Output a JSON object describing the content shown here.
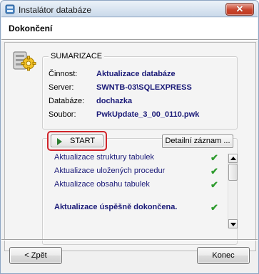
{
  "window": {
    "title": "Instalátor databáze"
  },
  "header": {
    "title": "Dokončení"
  },
  "summary": {
    "group_title": "SUMARIZACE",
    "rows": [
      {
        "label": "Činnost:",
        "value": "Aktualizace databáze"
      },
      {
        "label": "Server:",
        "value": "SWNTB-03\\SQLEXPRESS"
      },
      {
        "label": "Databáze:",
        "value": "dochazka"
      },
      {
        "label": "Soubor:",
        "value": "PwkUpdate_3_00_0110.pwk"
      }
    ]
  },
  "actions": {
    "start_label": "START",
    "detail_label": "Detailní záznam ..."
  },
  "log": {
    "items": [
      {
        "text": "Aktualizace struktury tabulek",
        "status": "done",
        "bold": false
      },
      {
        "text": "Aktualizace uložených procedur",
        "status": "done",
        "bold": false
      },
      {
        "text": "Aktualizace obsahu tabulek",
        "status": "done",
        "bold": false
      },
      {
        "text": "Aktualizace úspěšně dokončena.",
        "status": "done",
        "bold": true
      }
    ],
    "check_glyph": "✔"
  },
  "footer": {
    "back_label": "< Zpět",
    "finish_label": "Konec"
  },
  "colors": {
    "highlight": "#d0242a",
    "value_text": "#1a1a78",
    "check": "#2e9b2e"
  },
  "icons": [
    "database-installer-icon",
    "close-icon",
    "wizard-gear-icon",
    "play-icon",
    "check-icon",
    "scroll-up-icon",
    "scroll-down-icon"
  ]
}
